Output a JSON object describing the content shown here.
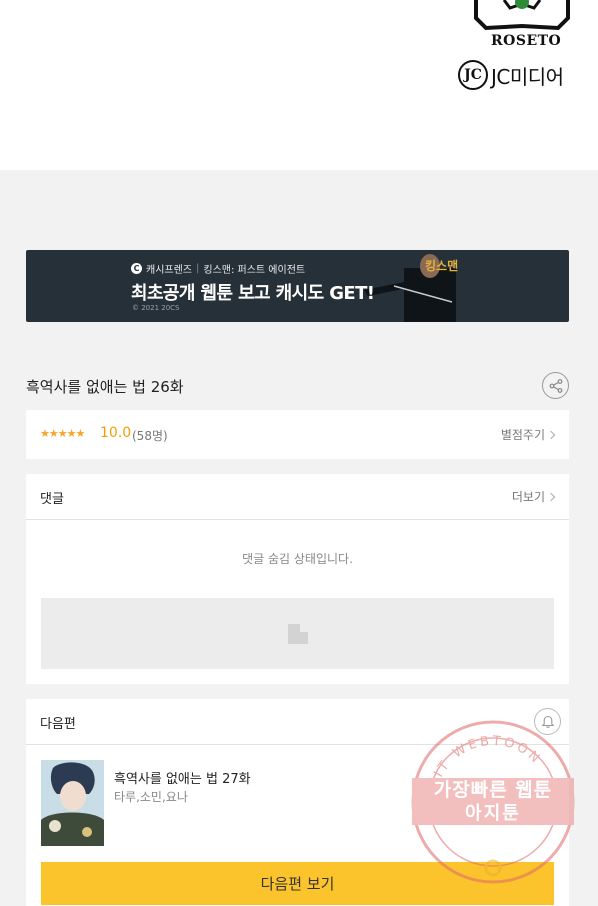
{
  "logos": {
    "publisher": "ROSETO",
    "jc_mark": "JC",
    "jc_text": "JC미디어"
  },
  "banner": {
    "brand": "캐시프렌즈",
    "movie": "킹스맨: 퍼스트 에이전트",
    "headline": "최초공개 웹툰 보고 캐시도 GET!",
    "copyright": "© 2021 20CS",
    "movie_title": "킹스맨"
  },
  "episode": {
    "title": "흑역사를 없애는 법 26화"
  },
  "rating": {
    "stars_text": "★★★★★",
    "value": "10.0",
    "count": "(58명)",
    "rate_label": "별점주기",
    "score": 10.0
  },
  "comments": {
    "title": "댓글",
    "more_label": "더보기",
    "hidden_message": "댓글 숨김 상태입니다."
  },
  "next": {
    "section_label": "다음편",
    "title": "흑역사를 없애는 법 27화",
    "authors": "타루,소민,요나",
    "button_label": "다음편 보기"
  },
  "watermark": {
    "arc_text": "AGIT WEBTOON",
    "line1": "가장빠른 웹툰",
    "line2": "아지툰"
  },
  "colors": {
    "accent_yellow": "#fcc42c",
    "rating_orange": "#f09d0a",
    "banner_bg": "#253038",
    "page_bg": "#f2f2f2"
  }
}
